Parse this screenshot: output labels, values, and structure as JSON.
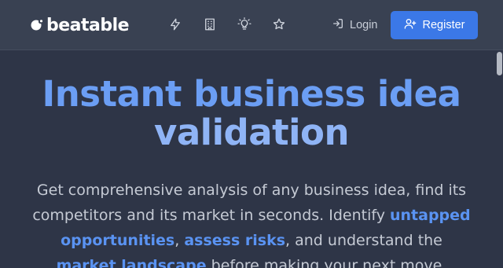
{
  "header": {
    "logo_text": "beatable",
    "nav": [
      {
        "icon": "bolt-icon"
      },
      {
        "icon": "building-icon"
      },
      {
        "icon": "lightbulb-icon"
      },
      {
        "icon": "star-icon"
      }
    ],
    "login_label": "Login",
    "register_label": "Register"
  },
  "hero": {
    "title_line1": "Instant business idea",
    "title_line2": "validation",
    "desc_part1": "Get comprehensive analysis of any business idea, find its competitors and its market in seconds. Identify ",
    "link1": "untapped opportunities",
    "sep1": ", ",
    "link2": "assess risks",
    "desc_part2": ", and understand the ",
    "link3": "market landscape",
    "desc_part3": " before making your next move."
  },
  "colors": {
    "accent": "#3b78e7",
    "title": "#6b9ef4",
    "background": "#2e3547",
    "header": "#394152"
  }
}
